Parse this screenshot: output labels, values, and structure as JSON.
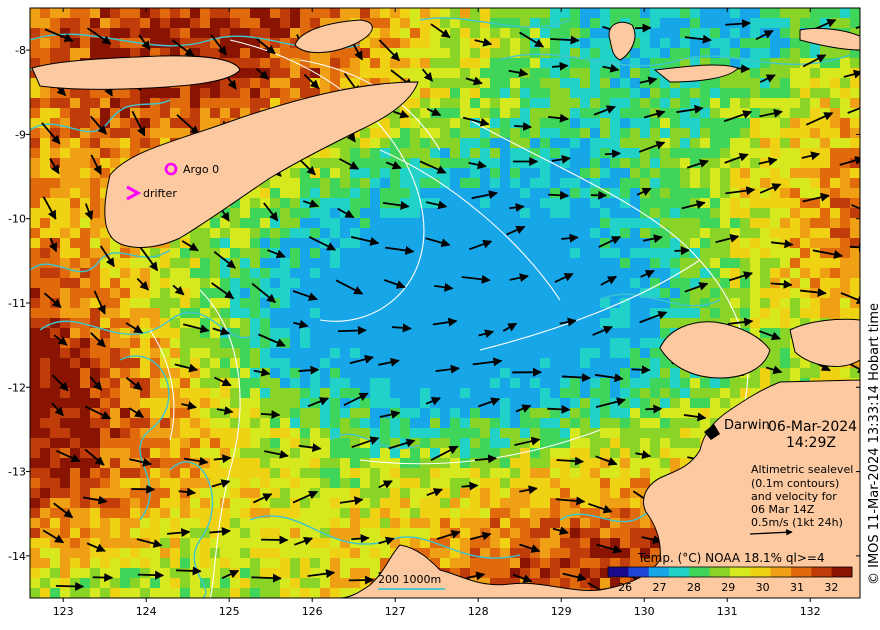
{
  "map": {
    "lon_ticks": [
      "123",
      "124",
      "125",
      "126",
      "127",
      "128",
      "129",
      "130",
      "131",
      "132"
    ],
    "lat_ticks": [
      "-8",
      "-9",
      "-10",
      "-11",
      "-12",
      "-13",
      "-14"
    ],
    "lon_range": [
      122.6,
      132.6
    ],
    "lat_range": [
      -7.5,
      -14.5
    ]
  },
  "labels": {
    "argo": "Argo 0",
    "drifter": "drifter",
    "darwin": "Darwin",
    "date": "06-Mar-2024",
    "time": "14:29Z",
    "legend_lines": [
      "Altimetric sealevel",
      "(0.1m contours)",
      "and velocity for",
      "06 Mar 14Z",
      "0.5m/s (1kt 24h)"
    ],
    "bathy_scale": "200  1000m",
    "colorbar_title": "Temp. (°C) NOAA 18.1% ql>=4",
    "credit": "© IMOS 11-Mar-2024 13:33:14 Hobart time"
  },
  "colorbar": {
    "ticks": [
      "26",
      "27",
      "28",
      "29",
      "30",
      "31",
      "32"
    ],
    "range": [
      25.5,
      32.6
    ],
    "colors": [
      "#1a0a8c",
      "#1d45d6",
      "#17a6e8",
      "#21d2c8",
      "#3fd45a",
      "#8ad428",
      "#d6e81e",
      "#f0d214",
      "#f0a014",
      "#e06a0c",
      "#c03c08",
      "#8a1402"
    ]
  },
  "colors": {
    "land": "#fcc9a0",
    "bathy": "#3ec6cf",
    "argo": "#ff00ff",
    "drifter": "#ff00ff",
    "contour": "#ffffff"
  }
}
